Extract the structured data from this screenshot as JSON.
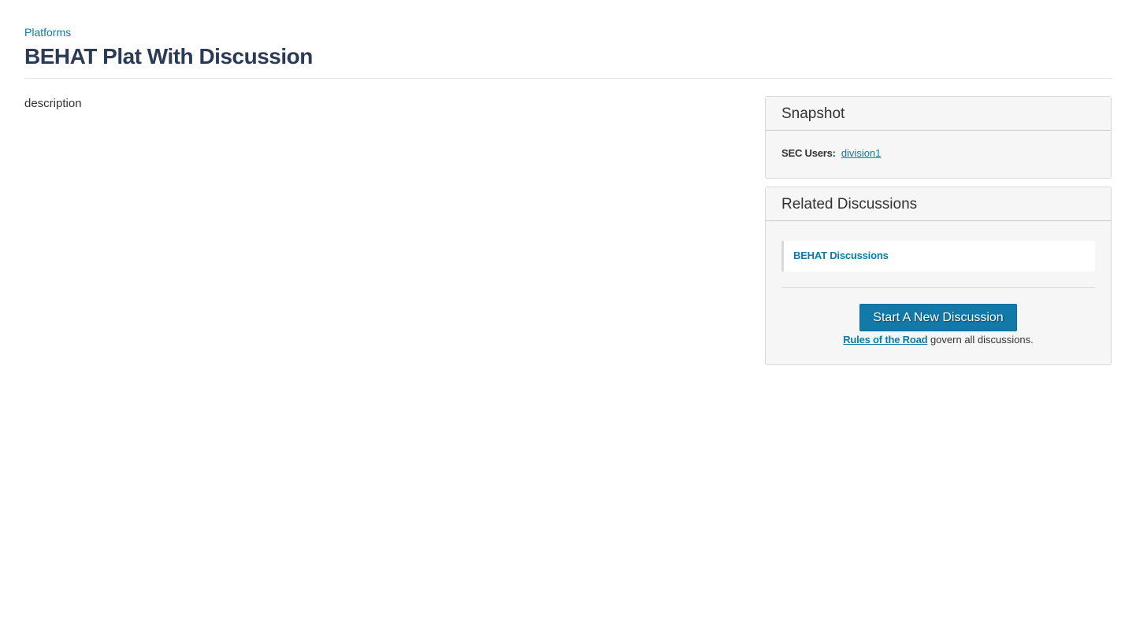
{
  "breadcrumb": {
    "label": "Platforms"
  },
  "page": {
    "title": "BEHAT Plat With Discussion",
    "description": "description"
  },
  "snapshot": {
    "title": "Snapshot",
    "sec_users_label": "SEC Users:",
    "sec_users_value": "division1"
  },
  "related": {
    "title": "Related Discussions",
    "discussions": [
      {
        "label": "BEHAT Discussions"
      }
    ],
    "new_discussion_button": "Start A New Discussion",
    "rules_link": "Rules of the Road",
    "rules_suffix": " govern all discussions."
  },
  "colors": {
    "link": "#0e7aa8",
    "title": "#2b3b55",
    "button": "#1279a8",
    "panel_bg": "#f6f6f6"
  }
}
